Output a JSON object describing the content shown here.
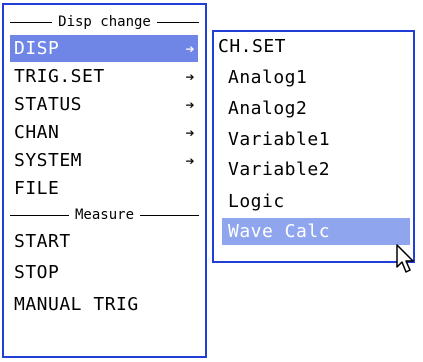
{
  "menu": {
    "header_disp": "Disp change",
    "items": [
      {
        "label": "DISP",
        "arrow": "➔"
      },
      {
        "label": "TRIG.SET",
        "arrow": "➔"
      },
      {
        "label": "STATUS",
        "arrow": "➔"
      },
      {
        "label": "CHAN",
        "arrow": "➔"
      },
      {
        "label": "SYSTEM",
        "arrow": "➔"
      },
      {
        "label": "FILE",
        "arrow": ""
      }
    ],
    "header_measure": "Measure",
    "measure_items": [
      {
        "label": "START"
      },
      {
        "label": "STOP"
      },
      {
        "label": "MANUAL TRIG"
      }
    ]
  },
  "submenu": {
    "title": "CH.SET",
    "items": [
      {
        "label": "Analog1"
      },
      {
        "label": "Analog2"
      },
      {
        "label": "Variable1"
      },
      {
        "label": "Variable2"
      },
      {
        "label": "Logic"
      },
      {
        "label": "Wave Calc"
      }
    ]
  },
  "colors": {
    "border": "#1f3fd6",
    "menu_highlight": "#6f86e6",
    "submenu_highlight": "#8fa6ee"
  },
  "icons": {
    "arrow": "arrow-right-icon",
    "cursor": "mouse-pointer-icon"
  }
}
